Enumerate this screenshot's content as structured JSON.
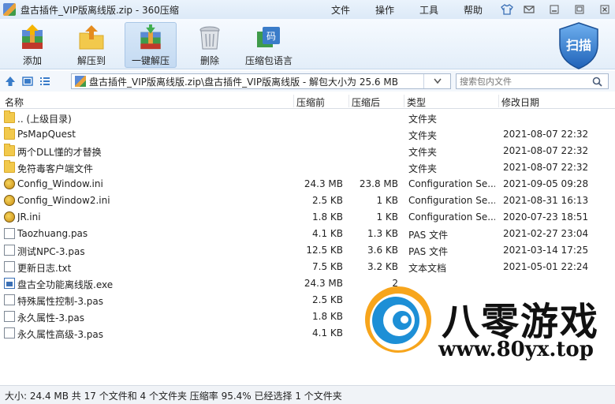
{
  "window": {
    "title": "盘古插件_VIP版离线版.zip - 360压缩"
  },
  "menu": [
    "文件",
    "操作",
    "工具",
    "帮助"
  ],
  "toolbar": {
    "add": "添加",
    "extract_to": "解压到",
    "one_click": "一键解压",
    "delete": "删除",
    "language": "压缩包语言",
    "scan": "扫描"
  },
  "address": {
    "path": "盘古插件_VIP版离线版.zip\\盘古插件_VIP版离线版 - 解包大小为 25.6 MB",
    "search_placeholder": "搜索包内文件"
  },
  "columns": {
    "name": "名称",
    "size": "压缩前",
    "compressed": "压缩后",
    "type": "类型",
    "date": "修改日期"
  },
  "files": [
    {
      "icon": "folder-icon",
      "name": ".. (上级目录)",
      "size": "",
      "compressed": "",
      "type": "文件夹",
      "date": ""
    },
    {
      "icon": "folder-icon",
      "name": "PsMapQuest",
      "size": "",
      "compressed": "",
      "type": "文件夹",
      "date": "2021-08-07 22:32"
    },
    {
      "icon": "folder-icon",
      "name": "两个DLL懂的才替换",
      "size": "",
      "compressed": "",
      "type": "文件夹",
      "date": "2021-08-07 22:32"
    },
    {
      "icon": "folder-icon",
      "name": "免符毒客户端文件",
      "size": "",
      "compressed": "",
      "type": "文件夹",
      "date": "2021-08-07 22:32"
    },
    {
      "icon": "ini-icon",
      "name": "Config_Window.ini",
      "size": "24.3 MB",
      "compressed": "23.8 MB",
      "type": "Configuration Se...",
      "date": "2021-09-05 09:28"
    },
    {
      "icon": "ini-icon",
      "name": "Config_Window2.ini",
      "size": "2.5 KB",
      "compressed": "1 KB",
      "type": "Configuration Se...",
      "date": "2021-08-31 16:13"
    },
    {
      "icon": "ini-icon",
      "name": "JR.ini",
      "size": "1.8 KB",
      "compressed": "1 KB",
      "type": "Configuration Se...",
      "date": "2020-07-23 18:51"
    },
    {
      "icon": "document-icon",
      "name": "Taozhuang.pas",
      "size": "4.1 KB",
      "compressed": "1.3 KB",
      "type": "PAS 文件",
      "date": "2021-02-27 23:04"
    },
    {
      "icon": "document-icon",
      "name": "测试NPC-3.pas",
      "size": "12.5 KB",
      "compressed": "3.6 KB",
      "type": "PAS 文件",
      "date": "2021-03-14 17:25"
    },
    {
      "icon": "document-icon",
      "name": "更新日志.txt",
      "size": "7.5 KB",
      "compressed": "3.2 KB",
      "type": "文本文档",
      "date": "2021-05-01 22:24"
    },
    {
      "icon": "exe-icon",
      "name": "盘古全功能离线版.exe",
      "size": "24.3 MB",
      "compressed": "2",
      "type": "",
      "date": ""
    },
    {
      "icon": "document-icon",
      "name": "特殊属性控制-3.pas",
      "size": "2.5 KB",
      "compressed": "",
      "type": "",
      "date": ""
    },
    {
      "icon": "document-icon",
      "name": "永久属性-3.pas",
      "size": "1.8 KB",
      "compressed": "",
      "type": "",
      "date": ""
    },
    {
      "icon": "document-icon",
      "name": "永久属性高级-3.pas",
      "size": "4.1 KB",
      "compressed": "",
      "type": "",
      "date": ""
    }
  ],
  "watermark": {
    "title": "八零游戏",
    "url": "www.80yx.top"
  },
  "status": {
    "text": "大小: 24.4 MB 共 17 个文件和 4 个文件夹 压缩率 95.4% 已经选择 1 个文件夹"
  }
}
